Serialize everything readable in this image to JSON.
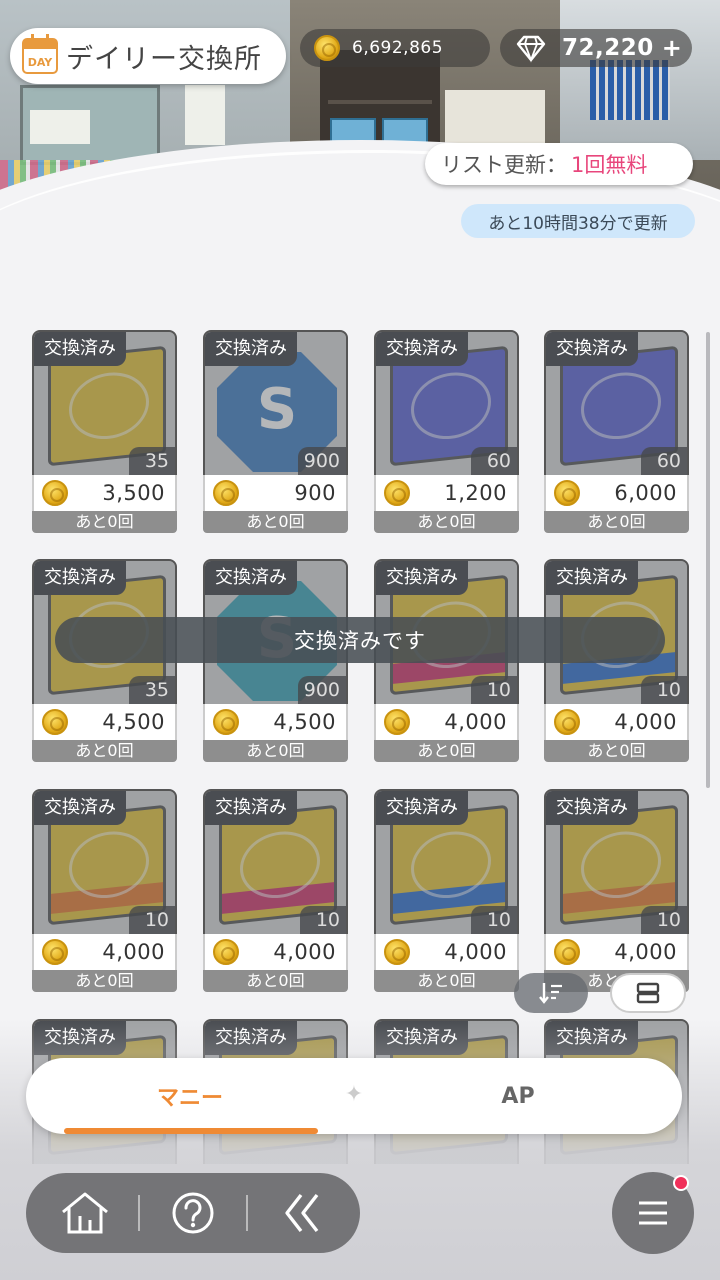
{
  "header": {
    "day_icon_label": "DAY",
    "title": "デイリー交換所",
    "coins": "6,692,865",
    "gems": "72,220",
    "gems_plus": "+",
    "refresh_label": "リスト更新：",
    "refresh_free": "1回無料",
    "timer": "あと10時間38分で更新"
  },
  "items": [
    {
      "tag": "交換済み",
      "kind": "book",
      "color": "#e8c53a",
      "qty": "35",
      "price": "3,500",
      "remain": "あと0回"
    },
    {
      "tag": "交換済み",
      "kind": "s-badge",
      "color": "#3f7fc4",
      "qty": "900",
      "price": "900",
      "remain": "あと0回",
      "icon_text": "S"
    },
    {
      "tag": "交換済み",
      "kind": "book",
      "color": "#5b63d6",
      "qty": "60",
      "price": "1,200",
      "remain": "あと0回"
    },
    {
      "tag": "交換済み",
      "kind": "book",
      "color": "#5b63d6",
      "qty": "60",
      "price": "6,000",
      "remain": "あと0回"
    },
    {
      "tag": "交換済み",
      "kind": "book",
      "color": "#e8c53a",
      "qty": "35",
      "price": "4,500",
      "remain": "あと0回"
    },
    {
      "tag": "交換済み",
      "kind": "s-badge",
      "color": "#3aa4b8",
      "qty": "900",
      "price": "4,500",
      "remain": "あと0回",
      "icon_text": "S"
    },
    {
      "tag": "交換済み",
      "kind": "book",
      "color": "#e8c53a",
      "band": "#d2336a",
      "qty": "10",
      "price": "4,000",
      "remain": "あと0回"
    },
    {
      "tag": "交換済み",
      "kind": "book",
      "color": "#e8c53a",
      "band": "#2f6fd0",
      "qty": "10",
      "price": "4,000",
      "remain": "あと0回"
    },
    {
      "tag": "交換済み",
      "kind": "book",
      "color": "#e8c53a",
      "band": "#e77a2e",
      "qty": "10",
      "price": "4,000",
      "remain": "あと0回"
    },
    {
      "tag": "交換済み",
      "kind": "book",
      "color": "#e8c53a",
      "band": "#d2336a",
      "qty": "10",
      "price": "4,000",
      "remain": "あと0回"
    },
    {
      "tag": "交換済み",
      "kind": "book",
      "color": "#e8c53a",
      "band": "#2f6fd0",
      "qty": "10",
      "price": "4,000",
      "remain": "あと0回"
    },
    {
      "tag": "交換済み",
      "kind": "book",
      "color": "#e8c53a",
      "band": "#e77a2e",
      "qty": "10",
      "price": "4,000",
      "remain": "あと0回"
    },
    {
      "tag": "交換済み",
      "kind": "book",
      "color": "#e8c53a",
      "qty": "",
      "price": "",
      "remain": ""
    },
    {
      "tag": "交換済み",
      "kind": "book",
      "color": "#e8c53a",
      "qty": "",
      "price": "",
      "remain": ""
    },
    {
      "tag": "交換済み",
      "kind": "book",
      "color": "#e8c53a",
      "qty": "",
      "price": "",
      "remain": ""
    },
    {
      "tag": "交換済み",
      "kind": "book",
      "color": "#e8c53a",
      "qty": "",
      "price": "",
      "remain": ""
    }
  ],
  "toast": "交換済みです",
  "tabs": {
    "money": "マニー",
    "divider": "✦",
    "ap": "AP"
  },
  "icons": {
    "sort": "sort-icon",
    "view": "list-view-icon",
    "home": "home-icon",
    "help": "help-icon",
    "back": "back-icon",
    "menu": "menu-icon"
  },
  "colors": {
    "accent": "#ef8a34",
    "free_text": "#e8467c",
    "notification": "#f0305a"
  }
}
